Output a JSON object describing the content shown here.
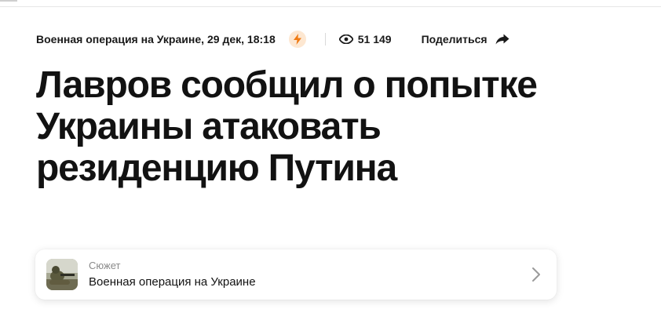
{
  "article": {
    "rubric": "Военная операция на Украине",
    "datetime": "29 дек, 18:18",
    "views": "51 149",
    "share_label": "Поделиться",
    "title": "Лавров сообщил о попытке Украины атаковать резиденцию Путина"
  },
  "story": {
    "label": "Сюжет",
    "name": "Военная операция на Украине"
  },
  "icons": {
    "lightning": "lightning-icon",
    "eye": "eye-icon",
    "share": "share-arrow-icon",
    "chevron": "chevron-right-icon"
  },
  "colors": {
    "lightning_bg": "#fde7d1",
    "lightning_fg": "#f07a12",
    "text": "#121212",
    "muted": "#8a8a8a"
  }
}
